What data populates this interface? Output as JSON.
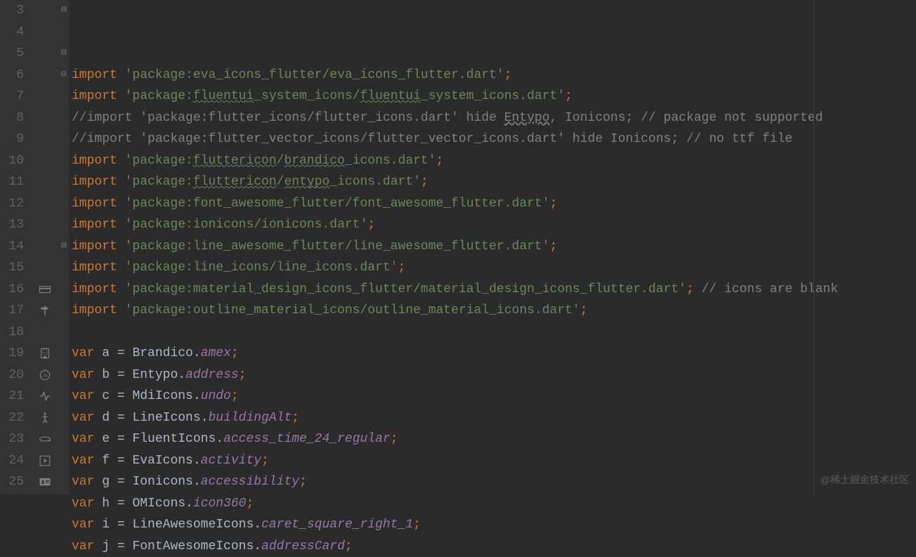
{
  "watermark": "@稀土掘金技术社区",
  "lines": [
    {
      "num": "3",
      "fold": "⊟",
      "icon": null,
      "tokens": [
        {
          "cls": "kw",
          "t": "import "
        },
        {
          "cls": "str",
          "t": "'package:eva_icons_flutter/eva_icons_flutter.dart'"
        },
        {
          "cls": "semi",
          "t": ";"
        }
      ]
    },
    {
      "num": "4",
      "fold": "",
      "icon": null,
      "tokens": [
        {
          "cls": "kw",
          "t": "import "
        },
        {
          "cls": "str",
          "t": "'package:"
        },
        {
          "cls": "str-wavy",
          "t": "fluentui"
        },
        {
          "cls": "str",
          "t": "_system_icons/"
        },
        {
          "cls": "str-wavy",
          "t": "fluentui"
        },
        {
          "cls": "str",
          "t": "_system_icons.dart'"
        },
        {
          "cls": "semi",
          "t": ";"
        }
      ]
    },
    {
      "num": "5",
      "fold": "⊟",
      "icon": null,
      "tokens": [
        {
          "cls": "comment",
          "t": "//import 'package:flutter_icons/flutter_icons.dart' hide "
        },
        {
          "cls": "comment entypo-underline",
          "t": "Entypo"
        },
        {
          "cls": "comment",
          "t": ", Ionicons; // package not supported"
        }
      ]
    },
    {
      "num": "6",
      "fold": "⊟",
      "icon": null,
      "tokens": [
        {
          "cls": "comment",
          "t": "//import 'package:flutter_vector_icons/flutter_vector_icons.dart' hide Ionicons; // no ttf file"
        }
      ]
    },
    {
      "num": "7",
      "fold": "",
      "icon": null,
      "tokens": [
        {
          "cls": "kw",
          "t": "import "
        },
        {
          "cls": "str",
          "t": "'package:"
        },
        {
          "cls": "str-wavy",
          "t": "fluttericon"
        },
        {
          "cls": "str",
          "t": "/"
        },
        {
          "cls": "str-wavy",
          "t": "brandico"
        },
        {
          "cls": "str",
          "t": "_icons.dart'"
        },
        {
          "cls": "semi",
          "t": ";"
        }
      ]
    },
    {
      "num": "8",
      "fold": "",
      "icon": null,
      "tokens": [
        {
          "cls": "kw",
          "t": "import "
        },
        {
          "cls": "str",
          "t": "'package:"
        },
        {
          "cls": "str-wavy",
          "t": "fluttericon"
        },
        {
          "cls": "str",
          "t": "/"
        },
        {
          "cls": "str-wavy",
          "t": "entypo"
        },
        {
          "cls": "str",
          "t": "_icons.dart'"
        },
        {
          "cls": "semi",
          "t": ";"
        }
      ]
    },
    {
      "num": "9",
      "fold": "",
      "icon": null,
      "tokens": [
        {
          "cls": "kw",
          "t": "import "
        },
        {
          "cls": "str",
          "t": "'package:font_awesome_flutter/font_awesome_flutter.dart'"
        },
        {
          "cls": "semi",
          "t": ";"
        }
      ]
    },
    {
      "num": "10",
      "fold": "",
      "icon": null,
      "tokens": [
        {
          "cls": "kw",
          "t": "import "
        },
        {
          "cls": "str",
          "t": "'package:ionicons/ionicons.dart'"
        },
        {
          "cls": "semi",
          "t": ";"
        }
      ]
    },
    {
      "num": "11",
      "fold": "",
      "icon": null,
      "tokens": [
        {
          "cls": "kw",
          "t": "import "
        },
        {
          "cls": "str",
          "t": "'package:line_awesome_flutter/line_awesome_flutter.dart'"
        },
        {
          "cls": "semi",
          "t": ";"
        }
      ]
    },
    {
      "num": "12",
      "fold": "",
      "icon": null,
      "tokens": [
        {
          "cls": "kw",
          "t": "import "
        },
        {
          "cls": "str",
          "t": "'package:line_icons/line_icons.dart'"
        },
        {
          "cls": "semi",
          "t": ";"
        }
      ]
    },
    {
      "num": "13",
      "fold": "",
      "icon": null,
      "tokens": [
        {
          "cls": "kw",
          "t": "import "
        },
        {
          "cls": "str",
          "t": "'package:material_design_icons_flutter/material_design_icons_flutter.dart'"
        },
        {
          "cls": "semi",
          "t": ";"
        },
        {
          "cls": "comment",
          "t": " // icons are blank "
        }
      ]
    },
    {
      "num": "14",
      "fold": "⊟",
      "icon": null,
      "tokens": [
        {
          "cls": "kw",
          "t": "import "
        },
        {
          "cls": "str",
          "t": "'package:outline_material_icons/outline_material_icons.dart'"
        },
        {
          "cls": "semi",
          "t": ";"
        }
      ]
    },
    {
      "num": "15",
      "fold": "",
      "icon": null,
      "tokens": []
    },
    {
      "num": "16",
      "fold": "",
      "icon": "card",
      "tokens": [
        {
          "cls": "kw",
          "t": "var "
        },
        {
          "cls": "ident",
          "t": "a "
        },
        {
          "cls": "punct",
          "t": "= "
        },
        {
          "cls": "ident",
          "t": "Brandico."
        },
        {
          "cls": "prop",
          "t": "amex"
        },
        {
          "cls": "semi",
          "t": ";"
        }
      ]
    },
    {
      "num": "17",
      "fold": "",
      "icon": "signpost",
      "tokens": [
        {
          "cls": "kw",
          "t": "var "
        },
        {
          "cls": "ident",
          "t": "b "
        },
        {
          "cls": "punct",
          "t": "= "
        },
        {
          "cls": "ident",
          "t": "Entypo."
        },
        {
          "cls": "prop",
          "t": "address"
        },
        {
          "cls": "semi",
          "t": ";"
        }
      ]
    },
    {
      "num": "18",
      "fold": "",
      "icon": null,
      "tokens": [
        {
          "cls": "kw",
          "t": "var "
        },
        {
          "cls": "ident",
          "t": "c "
        },
        {
          "cls": "punct",
          "t": "= "
        },
        {
          "cls": "ident",
          "t": "MdiIcons."
        },
        {
          "cls": "prop",
          "t": "undo"
        },
        {
          "cls": "semi",
          "t": ";"
        }
      ]
    },
    {
      "num": "19",
      "fold": "",
      "icon": "building",
      "tokens": [
        {
          "cls": "kw",
          "t": "var "
        },
        {
          "cls": "ident",
          "t": "d "
        },
        {
          "cls": "punct",
          "t": "= "
        },
        {
          "cls": "ident",
          "t": "LineIcons."
        },
        {
          "cls": "prop",
          "t": "buildingAlt"
        },
        {
          "cls": "semi",
          "t": ";"
        }
      ]
    },
    {
      "num": "20",
      "fold": "",
      "icon": "clock24",
      "tokens": [
        {
          "cls": "kw",
          "t": "var "
        },
        {
          "cls": "ident",
          "t": "e "
        },
        {
          "cls": "punct",
          "t": "= "
        },
        {
          "cls": "ident",
          "t": "FluentIcons."
        },
        {
          "cls": "prop",
          "t": "access_time_24_regular"
        },
        {
          "cls": "semi",
          "t": ";"
        }
      ]
    },
    {
      "num": "21",
      "fold": "",
      "icon": "activity",
      "tokens": [
        {
          "cls": "kw",
          "t": "var "
        },
        {
          "cls": "ident",
          "t": "f "
        },
        {
          "cls": "punct",
          "t": "= "
        },
        {
          "cls": "ident",
          "t": "EvaIcons."
        },
        {
          "cls": "prop",
          "t": "activity"
        },
        {
          "cls": "semi",
          "t": ";"
        }
      ]
    },
    {
      "num": "22",
      "fold": "",
      "icon": "person",
      "tokens": [
        {
          "cls": "kw",
          "t": "var "
        },
        {
          "cls": "ident",
          "t": "g "
        },
        {
          "cls": "punct",
          "t": "= "
        },
        {
          "cls": "ident",
          "t": "Ionicons."
        },
        {
          "cls": "prop",
          "t": "accessibility"
        },
        {
          "cls": "semi",
          "t": ";"
        }
      ]
    },
    {
      "num": "23",
      "fold": "",
      "icon": "icon360",
      "tokens": [
        {
          "cls": "kw",
          "t": "var "
        },
        {
          "cls": "ident",
          "t": "h "
        },
        {
          "cls": "punct",
          "t": "= "
        },
        {
          "cls": "ident",
          "t": "OMIcons."
        },
        {
          "cls": "prop",
          "t": "icon360"
        },
        {
          "cls": "semi",
          "t": ";"
        }
      ]
    },
    {
      "num": "24",
      "fold": "",
      "icon": "caret-right",
      "tokens": [
        {
          "cls": "kw",
          "t": "var "
        },
        {
          "cls": "ident",
          "t": "i "
        },
        {
          "cls": "punct",
          "t": "= "
        },
        {
          "cls": "ident",
          "t": "LineAwesomeIcons."
        },
        {
          "cls": "prop",
          "t": "caret_square_right_1"
        },
        {
          "cls": "semi",
          "t": ";"
        }
      ]
    },
    {
      "num": "25",
      "fold": "",
      "icon": "address-card",
      "tokens": [
        {
          "cls": "kw",
          "t": "var "
        },
        {
          "cls": "ident",
          "t": "j "
        },
        {
          "cls": "punct",
          "t": "= "
        },
        {
          "cls": "ident",
          "t": "FontAwesomeIcons."
        },
        {
          "cls": "prop",
          "t": "addressCard"
        },
        {
          "cls": "semi",
          "t": ";"
        }
      ]
    }
  ],
  "icons": {
    "card": "<svg class='icon-svg' viewBox='0 0 24 24'><rect x='2' y='6' width='20' height='12' rx='1' fill='none' stroke='#808080' stroke-width='1.5'/><rect x='2' y='9' width='20' height='2.5' fill='#808080'/></svg>",
    "signpost": "<svg class='icon-svg' viewBox='0 0 24 24'><path d='M11 3h2v18h-2z M4 6h12l3 2-3 2H4z' fill='#808080'/></svg>",
    "building": "<svg class='icon-svg' viewBox='0 0 24 24'><rect x='5' y='3' width='14' height='18' fill='none' stroke='#808080' stroke-width='1.5'/><path d='M8 6h2M8 10h2M8 14h2M14 6h2M14 10h2M14 14h2M10 18h4v3h-4z' stroke='#808080' stroke-width='1.2'/></svg>",
    "clock24": "<svg class='icon-svg' viewBox='0 0 24 24'><circle cx='12' cy='12' r='9' fill='none' stroke='#808080' stroke-width='1.5'/><text x='12' y='15' font-size='7' text-anchor='middle' fill='#808080' font-family='sans-serif'>24</text></svg>",
    "activity": "<svg class='icon-svg' viewBox='0 0 24 24'><path d='M3 12h4l3-8 4 16 3-8h4' fill='none' stroke='#808080' stroke-width='1.8' stroke-linecap='round' stroke-linejoin='round'/></svg>",
    "person": "<svg class='icon-svg' viewBox='0 0 24 24'><circle cx='12' cy='4' r='2' fill='#808080'/><path d='M12 7v8M8 10h8M9 21l3-6 3 6' fill='none' stroke='#808080' stroke-width='1.8' stroke-linecap='round'/></svg>",
    "icon360": "<svg class='icon-svg' viewBox='0 0 24 24'><ellipse cx='12' cy='12' rx='10' ry='4' fill='none' stroke='#808080' stroke-width='1.5'/><path d='M19 14l2 2 2-2' fill='none' stroke='#808080' stroke-width='1.5'/></svg>",
    "caret-right": "<svg class='icon-svg' viewBox='0 0 24 24'><rect x='3' y='3' width='18' height='18' fill='none' stroke='#808080' stroke-width='1.5'/><path d='M10 8l6 4-6 4z' fill='#808080'/></svg>",
    "address-card": "<svg class='icon-svg' viewBox='0 0 24 24'><rect x='2' y='5' width='20' height='14' rx='1' fill='#808080'/><circle cx='8' cy='11' r='2' fill='#2b2b2b'/><path d='M5 16c0-1.5 1.5-2.5 3-2.5s3 1 3 2.5' fill='#2b2b2b'/><rect x='13' y='9' width='7' height='1.5' fill='#2b2b2b'/><rect x='13' y='12' width='7' height='1.5' fill='#2b2b2b'/></svg>"
  }
}
